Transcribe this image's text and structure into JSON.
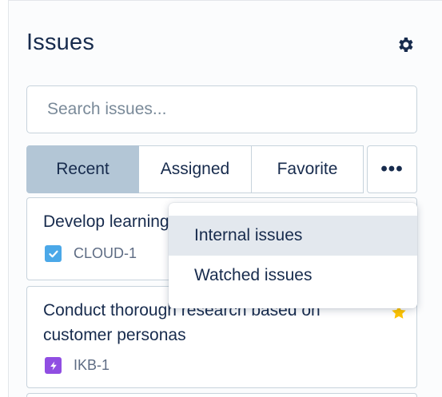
{
  "header": {
    "title": "Issues",
    "settings_icon": "gear-icon"
  },
  "search": {
    "placeholder": "Search issues...",
    "value": ""
  },
  "tabs": [
    {
      "label": "Recent",
      "active": true
    },
    {
      "label": "Assigned",
      "active": false
    },
    {
      "label": "Favorite",
      "active": false
    }
  ],
  "more_tab": {
    "label": "•••",
    "icon": "more-horizontal-icon"
  },
  "dropdown": {
    "items": [
      {
        "label": "Internal issues",
        "highlighted": true
      },
      {
        "label": "Watched issues",
        "highlighted": false
      }
    ]
  },
  "issues": [
    {
      "title": "Develop learning",
      "key": "CLOUD-1",
      "type_icon": "task-checkbox-icon",
      "type_color": "#4ba8e8",
      "favorite": false
    },
    {
      "title_line1": "Conduct thorough research based on",
      "title_line2": "customer personas",
      "key": "IKB-1",
      "type_icon": "epic-lightning-icon",
      "type_color": "#904ee2",
      "favorite": true,
      "star_color": "#ffc400"
    }
  ],
  "colors": {
    "active_tab": "#b3c6d6",
    "border": "#c7d3dc",
    "text": "#172b4d",
    "muted": "#5e6c84"
  }
}
